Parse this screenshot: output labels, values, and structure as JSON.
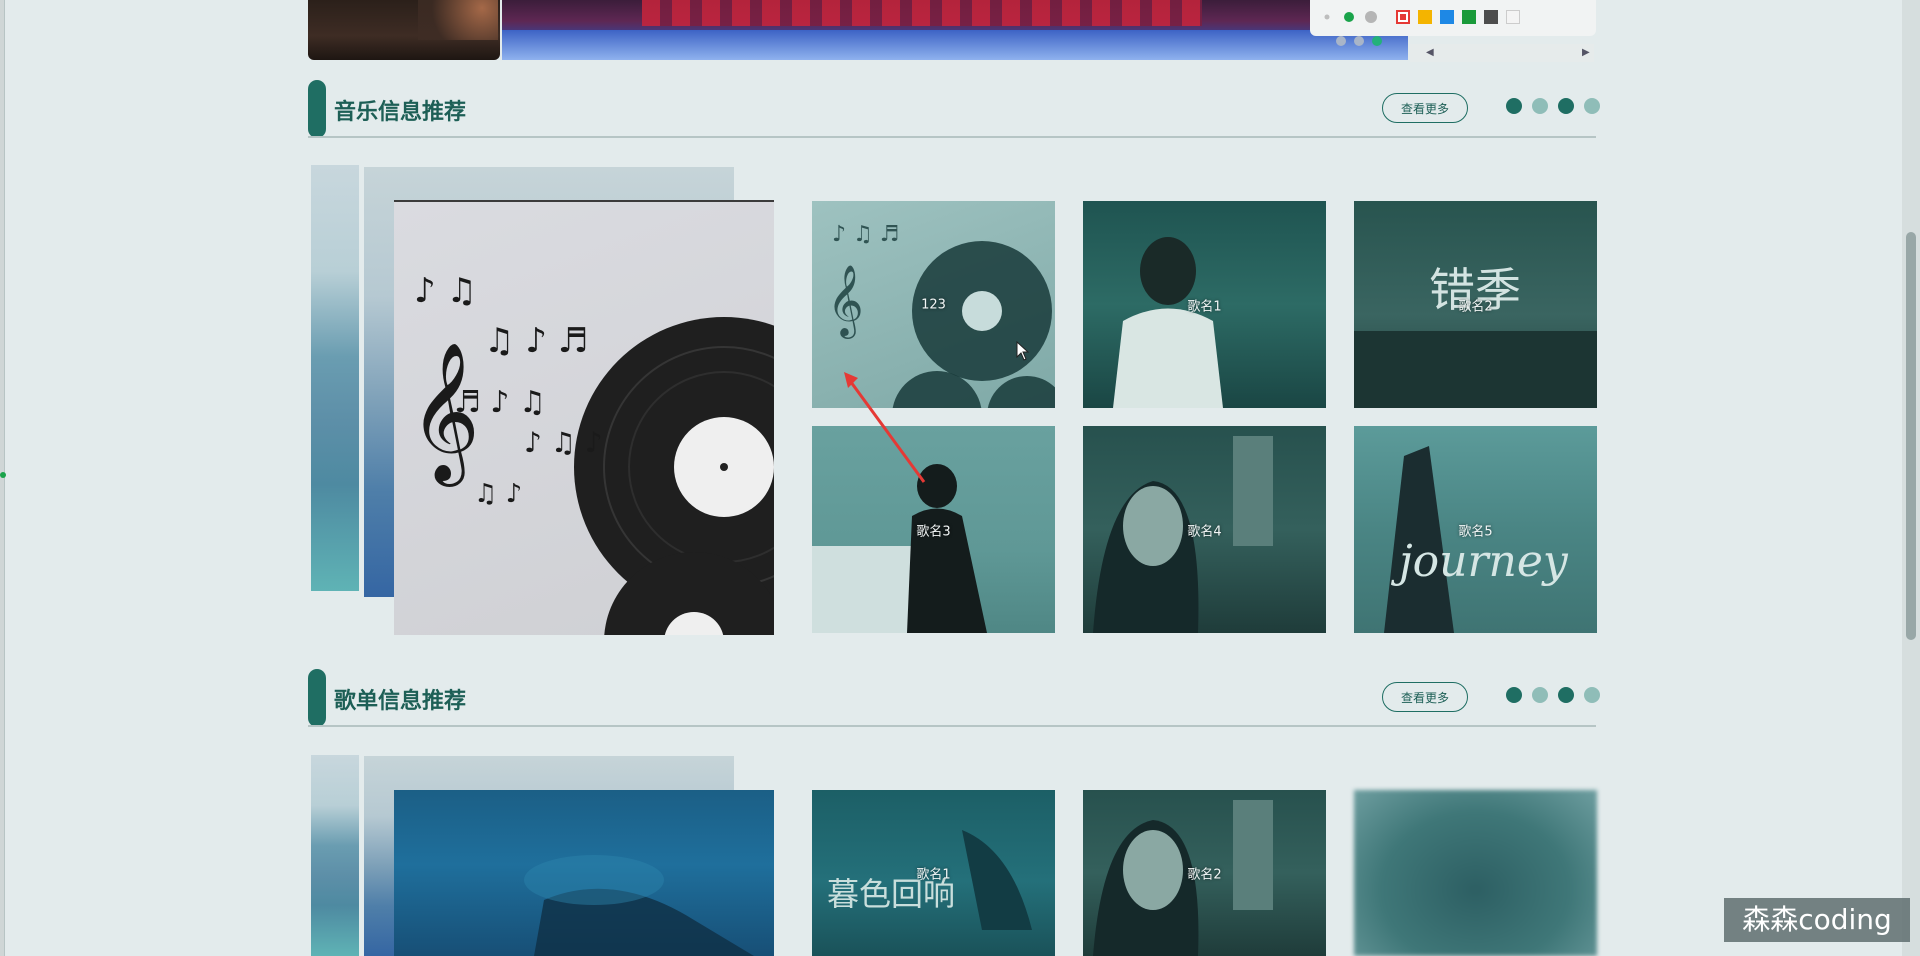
{
  "banner": {
    "dots": [
      false,
      false,
      true
    ]
  },
  "toolbar": {
    "icons": [
      "dot-icon",
      "green-dot-icon",
      "gray-dot-icon",
      "red-square-icon",
      "yellow-square-icon",
      "blue-square-icon",
      "green-square-icon",
      "dark-square-icon",
      "white-square-icon"
    ],
    "colors": [
      "#bdbdbd",
      "#1aa34a",
      "#b5b5b5",
      "#e53935",
      "#f4b400",
      "#1e88e5",
      "#1a9a3a",
      "#4d4d4d",
      "#f4f4f4"
    ]
  },
  "music_section": {
    "title": "音乐信息推荐",
    "more_label": "查看更多",
    "pager": [
      "dark",
      "light",
      "dark",
      "light"
    ],
    "songs": [
      {
        "label": "123",
        "art": "vinyl"
      },
      {
        "label": "歌名1",
        "art": "man"
      },
      {
        "label": "歌名2",
        "art": "city",
        "art_text": "错季"
      },
      {
        "label": "歌名3",
        "art": "sit"
      },
      {
        "label": "歌名4",
        "art": "woman"
      },
      {
        "label": "歌名5",
        "art": "journey",
        "art_text": "journey"
      }
    ]
  },
  "playlist_section": {
    "title": "歌单信息推荐",
    "more_label": "查看更多",
    "pager": [
      "dark",
      "light",
      "dark",
      "light"
    ],
    "items": [
      {
        "label": "歌名1",
        "art": "sea",
        "art_text": "暮色回响"
      },
      {
        "label": "歌名2",
        "art": "woman"
      },
      {
        "label": "",
        "art": "blur"
      }
    ]
  },
  "watermark": "森森coding",
  "colors": {
    "accent": "#1f6e63",
    "page_bg": "#e3ebec"
  }
}
